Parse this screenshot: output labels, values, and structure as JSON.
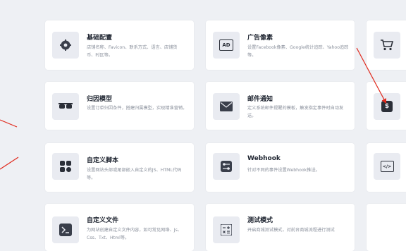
{
  "cards": {
    "basic": {
      "title": "基础配置",
      "desc": "店铺名称、Favicon、联系方式、语言、店铺货币、时区等。",
      "icon": "gear-icon"
    },
    "ad_pixel": {
      "title": "广告像素",
      "desc": "设置Facebook像素、Google统计追踪、Yahoo追踪等。",
      "icon": "ad-icon",
      "icon_text": "AD"
    },
    "attribution": {
      "title": "归因模型",
      "desc": "设置订单归因条件，搭建归属模型，实现精准营销。",
      "icon": "sunglasses-icon"
    },
    "email": {
      "title": "邮件通知",
      "desc": "定义系统邮件提醒的模板，触发指定事件时自动发送。",
      "icon": "envelope-icon"
    },
    "script": {
      "title": "自定义脚本",
      "desc": "设置网站头部或尾部嵌入自定义的JS、HTML代码等。",
      "icon": "apps-icon"
    },
    "webhook": {
      "title": "Webhook",
      "desc": "针对不同的事件设置Webhook推送。",
      "icon": "toggle-icon"
    },
    "files": {
      "title": "自定义文件",
      "desc": "为网站创建自定义文件内容，如可常见网络、Js、Css、Txt、Html等。",
      "icon": "terminal-icon"
    },
    "test_mode": {
      "title": "测试模式",
      "desc": "开启商城测试模式，对前台商城流程进行测试",
      "icon": "calculator-icon"
    },
    "right_column": [
      {
        "icon": "cart-icon"
      },
      {
        "icon": "money-icon",
        "icon_text": "$"
      },
      {
        "icon": "code-icon",
        "icon_text": "</>"
      }
    ]
  },
  "annotations": {
    "arrow_color": "#e0291c"
  }
}
